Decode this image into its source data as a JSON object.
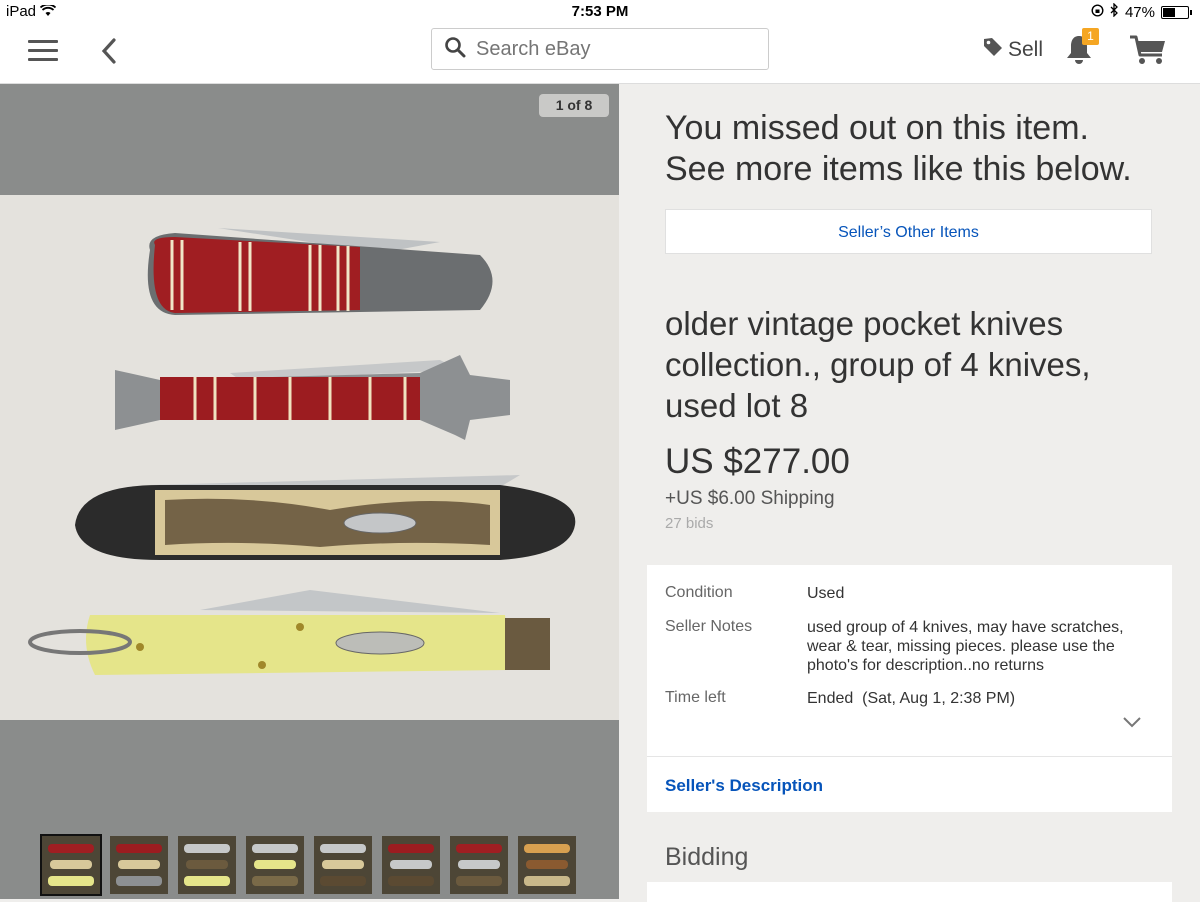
{
  "status_bar": {
    "device": "iPad",
    "time": "7:53 PM",
    "battery": "47%",
    "battery_level": 0.47
  },
  "navbar": {
    "search_placeholder": "Search eBay",
    "sell_label": "Sell",
    "notification_count": "1",
    "icons": [
      "hamburger-menu-icon",
      "back-chevron-icon",
      "search-icon",
      "tag-icon",
      "bell-icon",
      "cart-icon"
    ]
  },
  "gallery": {
    "counter": "1 of 8",
    "thumbnail_count": 8,
    "selected_index": 0
  },
  "listing": {
    "missed_line1": "You missed out on this item.",
    "missed_line2": "See more items like this below.",
    "other_items_button": "Seller’s Other Items",
    "title": "older vintage pocket knives collection., group of 4 knives, used lot 8",
    "price": "US $277.00",
    "shipping": "+US $6.00 Shipping",
    "bids": "27 bids"
  },
  "details": {
    "condition_label": "Condition",
    "condition_value": "Used",
    "notes_label": "Seller Notes",
    "notes_value": "used group of 4 knives, may have scratches, wear & tear, missing pieces. please use the photo's for description..no returns",
    "time_label": "Time left",
    "time_value": "Ended  (Sat, Aug 1, 2:38 PM)",
    "description_link": "Seller's Description"
  },
  "bidding": {
    "heading": "Bidding"
  },
  "colors": {
    "link": "#0654ba",
    "badge": "#f5a623",
    "gallery_bg": "#8a8c8b",
    "page_bg": "#efeeec"
  }
}
